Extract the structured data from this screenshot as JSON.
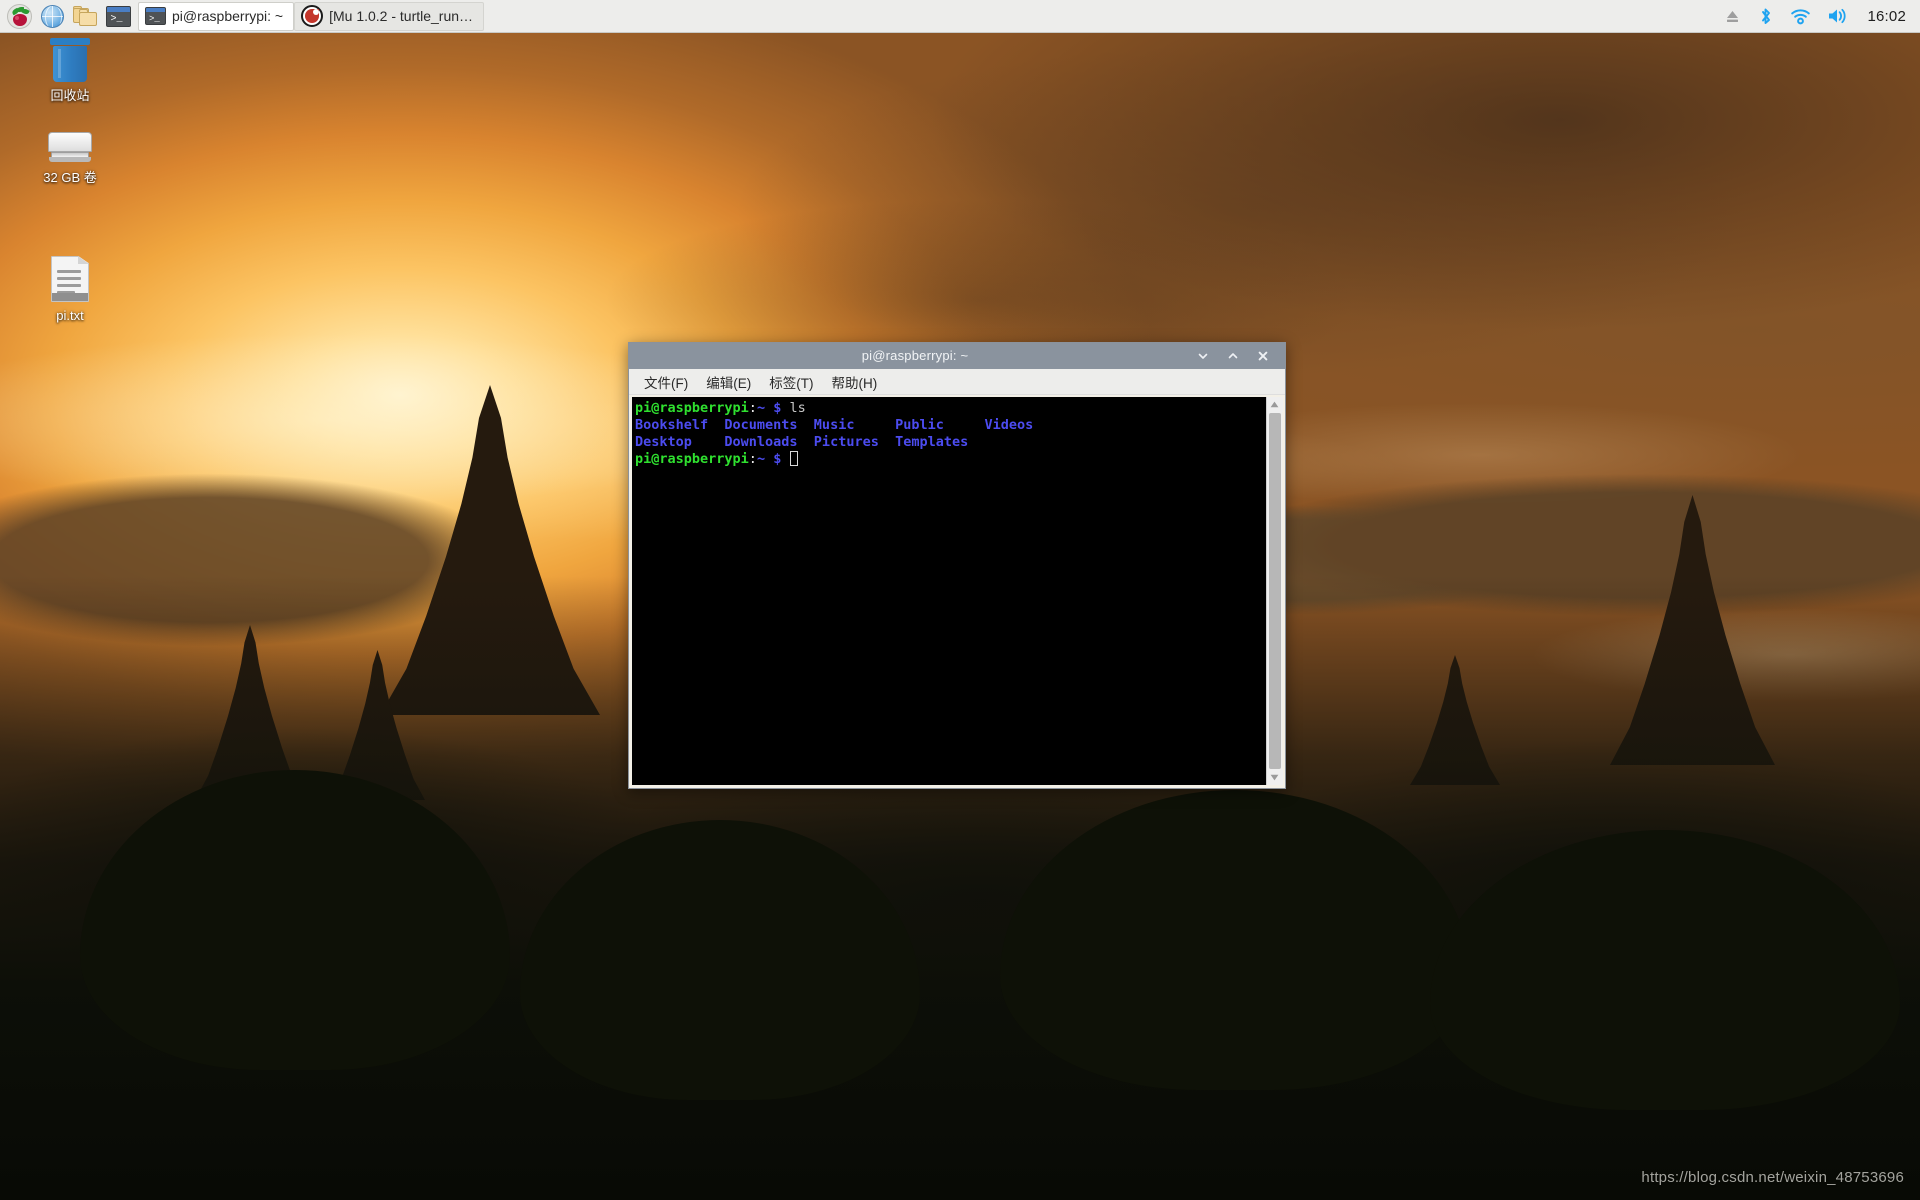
{
  "taskbar": {
    "launchers": [
      {
        "name": "raspberry-menu",
        "label": "Menu"
      },
      {
        "name": "web-browser",
        "label": "Web Browser"
      },
      {
        "name": "file-manager",
        "label": "File Manager"
      },
      {
        "name": "terminal-launcher",
        "label": "Terminal"
      }
    ],
    "windows": [
      {
        "name": "terminal-window-button",
        "label": "pi@raspberrypi: ~",
        "active": true
      },
      {
        "name": "mu-window-button",
        "label": "[Mu 1.0.2 - turtle_run…",
        "active": false
      }
    ],
    "tray": {
      "eject_label": "Eject",
      "bluetooth_label": "Bluetooth",
      "wifi_label": "Wireless & Wired Network",
      "volume_label": "Volume",
      "clock": "16:02"
    }
  },
  "desktop": {
    "icons": [
      {
        "name": "trash",
        "label": "回收站",
        "type": "trash"
      },
      {
        "name": "volume-32gb",
        "label": "32 GB 卷",
        "type": "drive"
      },
      {
        "name": "pi-txt",
        "label": "pi.txt",
        "type": "file"
      }
    ],
    "watermark": "https://blog.csdn.net/weixin_48753696"
  },
  "terminal": {
    "title": "pi@raspberrypi: ~",
    "controls": {
      "minimize": "˅",
      "maximize": "˄",
      "close": "✕"
    },
    "menu": [
      {
        "name": "menu-file",
        "label": "文件(F)"
      },
      {
        "name": "menu-edit",
        "label": "编辑(E)"
      },
      {
        "name": "menu-tabs",
        "label": "标签(T)"
      },
      {
        "name": "menu-help",
        "label": "帮助(H)"
      }
    ],
    "session": {
      "prompt_user": "pi@raspberrypi",
      "prompt_colon": ":",
      "prompt_path": "~",
      "prompt_dollar": "$",
      "command": "ls",
      "listing_row1": "Bookshelf  Documents  Music     Public     Videos",
      "listing_row2": "Desktop    Downloads  Pictures  Templates"
    },
    "colors": {
      "user": "#2fe02f",
      "path": "#4c4cf0",
      "dir": "#4c4cf0",
      "background": "#000000",
      "titlebar": "#8a939e"
    }
  }
}
